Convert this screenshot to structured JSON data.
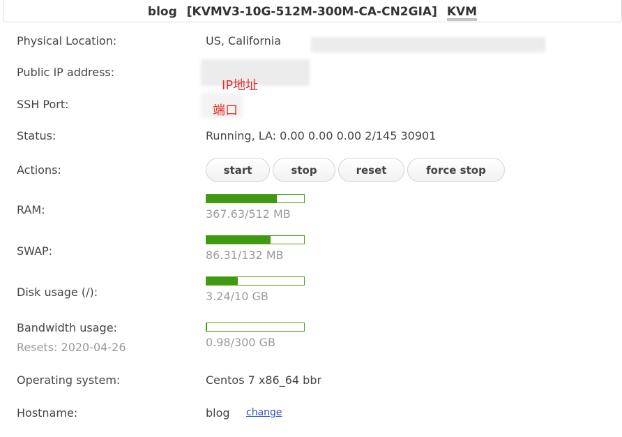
{
  "header": {
    "hostname": "blog",
    "plan": "[KVMV3-10G-512M-300M-CA-CN2GIA]",
    "virt_type": "KVM"
  },
  "labels": {
    "location": "Physical Location:",
    "ip": "Public IP address:",
    "ssh": "SSH Port:",
    "status": "Status:",
    "actions": "Actions:",
    "ram": "RAM:",
    "swap": "SWAP:",
    "disk": "Disk usage (/):",
    "bandwidth": "Bandwidth usage:",
    "bandwidth_reset": "Resets: 2020-04-26",
    "os": "Operating system:",
    "hostname": "Hostname:"
  },
  "values": {
    "location": "US, California",
    "ip_annotation": "IP地址",
    "ssh_annotation": "端口",
    "status": "Running, LA: 0.00 0.00 0.00 2/145 30901",
    "os": "Centos 7 x86_64 bbr",
    "hostname": "blog",
    "hostname_change": "change"
  },
  "actions": {
    "start": "start",
    "stop": "stop",
    "reset": "reset",
    "force_stop": "force stop"
  },
  "usage": {
    "ram": {
      "text": "367.63/512 MB",
      "used": 367.63,
      "total": 512
    },
    "swap": {
      "text": "86.31/132 MB",
      "used": 86.31,
      "total": 132
    },
    "disk": {
      "text": "3.24/10 GB",
      "used": 3.24,
      "total": 10
    },
    "bandwidth": {
      "text": "0.98/300 GB",
      "used": 0.98,
      "total": 300
    }
  },
  "colors": {
    "bar_fill": "#3f9a10",
    "bar_border": "#4aa11a",
    "annotation": "#e0302b",
    "link": "#2a4fbf"
  }
}
